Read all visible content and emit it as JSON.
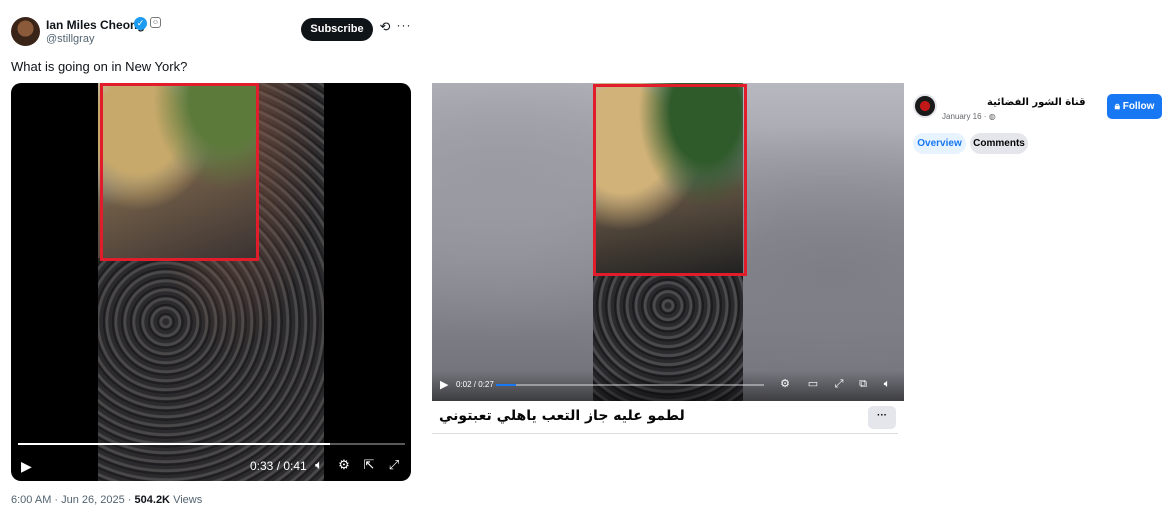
{
  "tweet": {
    "author_name": "Ian Miles Cheong",
    "handle": "@stillgray",
    "subscribe_label": "Subscribe",
    "text": "What is going on in New York?",
    "video": {
      "time": "0:33 / 0:41",
      "progress": 0.805
    },
    "meta": {
      "time": "6:00 AM · Jun 26, 2025 · ",
      "views_count": "504.2K",
      "views_label": " Views"
    }
  },
  "fb": {
    "video": {
      "time": "0:02 / 0:27",
      "progress": 0.074
    },
    "caption": "لطمو عليه جاز التعب ياهلي تعبتوني",
    "more_label": "···",
    "page": {
      "name": "قناة الشور الفضائية",
      "date": "January 16 · ◍",
      "follow_label": "Follow",
      "tabs": [
        {
          "label": "Overview",
          "active": true
        },
        {
          "label": "Comments",
          "active": false
        }
      ]
    }
  },
  "colors": {
    "highlight_box": "#e11d2b",
    "fb_blue": "#1877f2",
    "x_dark": "#0f1419"
  },
  "icons": [
    "verified-badge-icon",
    "grok-icon",
    "more-icon",
    "play-icon",
    "volume-icon",
    "settings-icon",
    "exit-pip-icon",
    "fullscreen-icon",
    "captions-icon",
    "pip-icon",
    "lock-icon"
  ]
}
